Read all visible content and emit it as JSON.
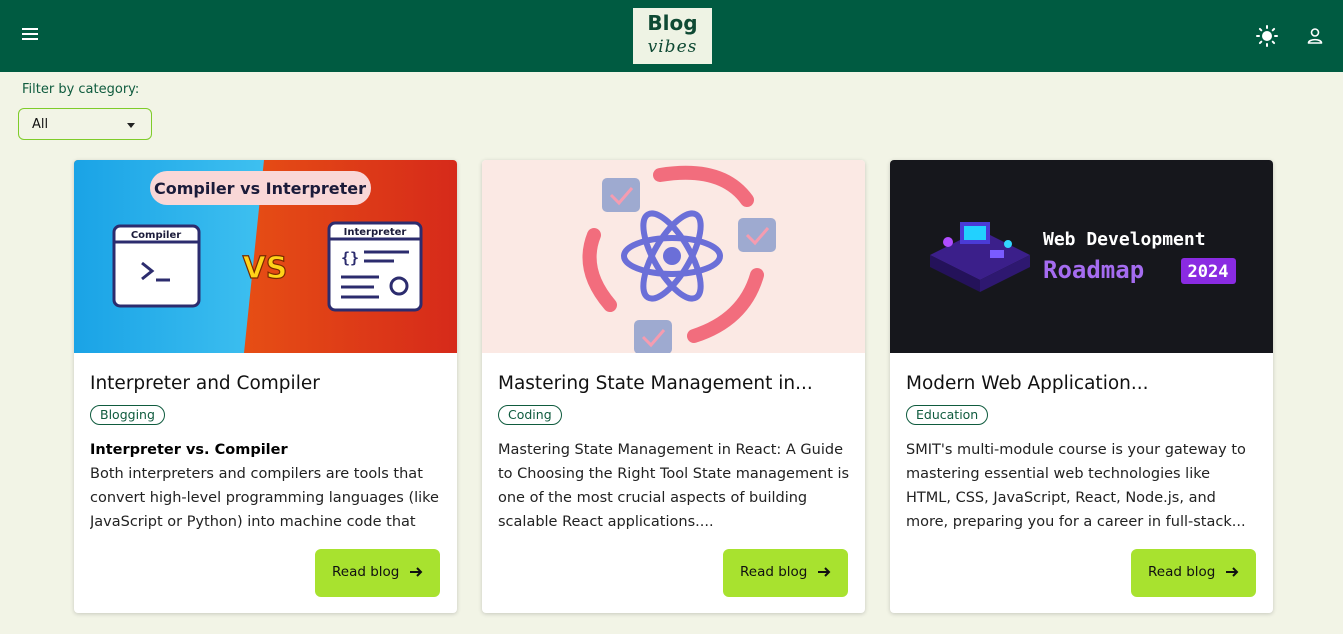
{
  "header": {
    "logo_line1": "Blog",
    "logo_line2": "vibes",
    "background": "#005b41",
    "icons": [
      "menu-icon",
      "sun-icon",
      "user-icon"
    ]
  },
  "filter": {
    "label": "Filter by category:",
    "selected": "All"
  },
  "cards": [
    {
      "title": "Interpreter and Compiler",
      "category": "Blogging",
      "excerpt_heading": "Interpreter vs. Compiler",
      "excerpt": "Both interpreters and compilers are tools that convert high-level programming languages (like JavaScript or Python) into machine code that a...",
      "button": "Read blog",
      "image": {
        "banner": "Compiler vs Interpreter",
        "left_box": "Compiler",
        "right_box": "Interpreter",
        "vs": "VS"
      }
    },
    {
      "title": "Mastering State Management in...",
      "category": "Coding",
      "excerpt_heading": "",
      "excerpt": "Mastering State Management in React: A Guide to Choosing the Right Tool State management is one of the most crucial aspects of building scalable React applications....",
      "button": "Read blog",
      "image": {
        "subject": "react-atom-icon"
      }
    },
    {
      "title": "Modern Web Application...",
      "category": "Education",
      "excerpt_heading": "",
      "excerpt": "SMIT's multi-module course is your gateway to mastering essential web technologies like HTML, CSS, JavaScript, React, Node.js, and more, preparing you for a career in full-stack...",
      "button": "Read blog",
      "image": {
        "line1": "Web Development",
        "line2": "Roadmap",
        "badge": "2024"
      }
    }
  ],
  "colors": {
    "page_bg": "#f2f4e6",
    "accent_green": "#a8e22f",
    "brand_dark": "#005b41"
  }
}
